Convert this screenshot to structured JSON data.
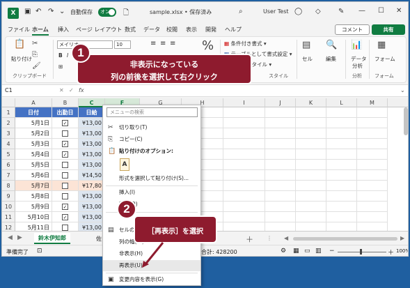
{
  "titlebar": {
    "logo": "X",
    "autosave_label": "自動保存",
    "autosave_state": "オン",
    "filename": "sample.xlsx • 保存済み",
    "user": "User Test"
  },
  "menu_tabs": [
    "ファイル",
    "ホーム",
    "挿入",
    "ページ レイアウト",
    "数式",
    "データ",
    "校閲",
    "表示",
    "開発",
    "ヘルプ"
  ],
  "comment_btn": "コメント",
  "share_btn": "共有",
  "ribbon": {
    "paste": "貼り付け",
    "clipboard": "クリップボード",
    "font_name": "メイリオ",
    "font_size": "10",
    "cond_format": "条件付き書式",
    "table_format": "テーブルとして書式設定",
    "cell_style": "セルのスタイル",
    "style_group": "スタイル",
    "cells": "セル",
    "editing": "編集",
    "analysis1": "データ",
    "analysis2": "分析",
    "analysis_group": "分析",
    "form": "フォーム",
    "form_group": "フォーム"
  },
  "formula_bar": {
    "name": "C1",
    "fx": "fx"
  },
  "columns": [
    "A",
    "B",
    "C",
    "F",
    "G",
    "H",
    "I",
    "J",
    "K",
    "L",
    "M"
  ],
  "table_headers": [
    "日付",
    "出勤日",
    "日給"
  ],
  "rows": [
    {
      "n": "1"
    },
    {
      "n": "2",
      "date": "5月1日",
      "checked": true,
      "val": "¥13,00"
    },
    {
      "n": "3",
      "date": "5月2日",
      "checked": false,
      "val": "¥13,00"
    },
    {
      "n": "4",
      "date": "5月3日",
      "checked": true,
      "val": "¥13,00"
    },
    {
      "n": "5",
      "date": "5月4日",
      "checked": true,
      "val": "¥13,00"
    },
    {
      "n": "6",
      "date": "5月5日",
      "checked": false,
      "val": "¥13,00"
    },
    {
      "n": "7",
      "date": "5月6日",
      "checked": false,
      "val": "¥14,50"
    },
    {
      "n": "8",
      "date": "5月7日",
      "checked": false,
      "val": "¥17,80",
      "highlight": true
    },
    {
      "n": "9",
      "date": "5月8日",
      "checked": false,
      "val": "¥13,00"
    },
    {
      "n": "10",
      "date": "5月9日",
      "checked": true,
      "val": "¥13,00"
    },
    {
      "n": "11",
      "date": "5月10日",
      "checked": true,
      "val": "¥13,00"
    },
    {
      "n": "12",
      "date": "5月11日",
      "checked": false,
      "val": "¥13,00"
    }
  ],
  "sheet_tab": "鈴木伊知郎",
  "sheet_tab2": "佐",
  "status": {
    "ready": "準備完了",
    "summary": "数: 63   合計: 428200",
    "zoom": "100%"
  },
  "context_menu": {
    "search_placeholder": "メニューの検索",
    "cut": "切り取り(T)",
    "copy": "コピー(C)",
    "paste_options": "貼り付けのオプション:",
    "paste_special": "形式を選択して貼り付け(S)...",
    "insert": "挿入(I)",
    "delete": "削除(D)",
    "cell_format": "セルの書式設定(F)...",
    "col_width": "列の幅(W)...",
    "hide": "非表示(H)",
    "unhide": "再表示(U)",
    "show_changes": "変更内容を表示(G)"
  },
  "callout1": {
    "num": "1",
    "line1": "非表示になっている",
    "line2": "列の前後を選択して右クリック"
  },
  "callout2": {
    "num": "2",
    "text": "［再表示］を選択"
  }
}
